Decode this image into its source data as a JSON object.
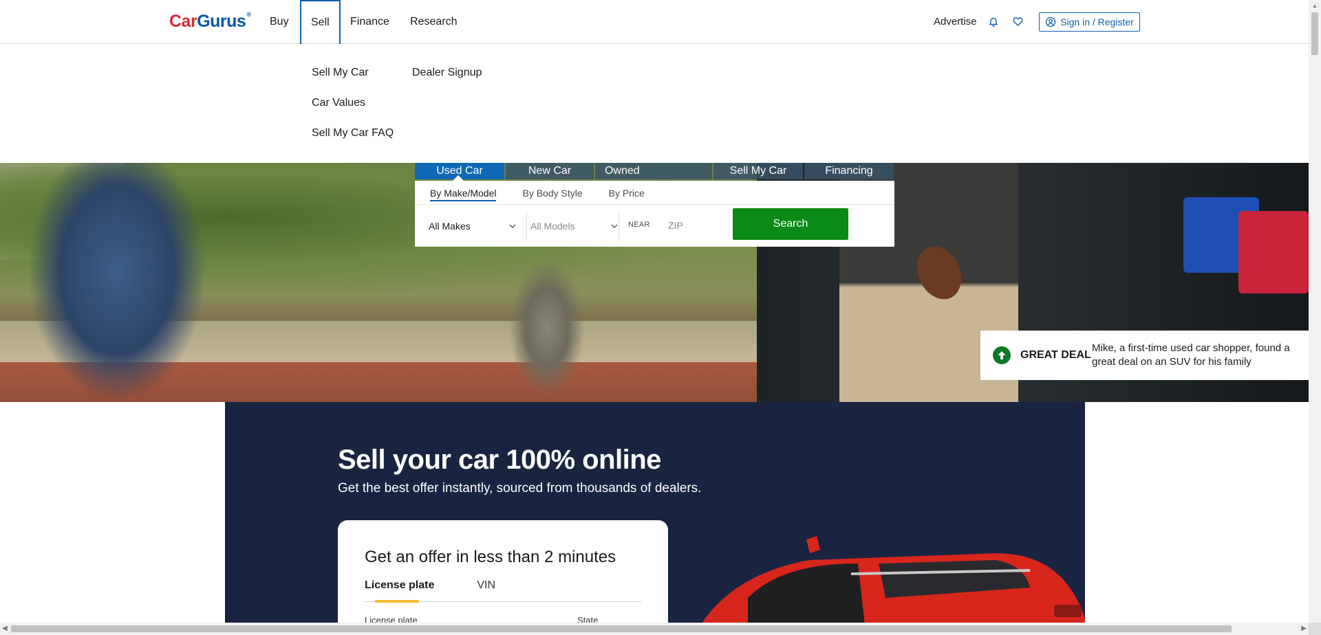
{
  "header": {
    "logo_car": "Car",
    "logo_gurus": "Gurus",
    "logo_reg": "®",
    "nav": {
      "buy": "Buy",
      "sell": "Sell",
      "finance": "Finance",
      "research": "Research"
    },
    "advertise": "Advertise",
    "signin": "Sign in / Register"
  },
  "sell_menu": {
    "sell_my_car": "Sell My Car",
    "car_values": "Car Values",
    "sell_faq": "Sell My Car FAQ",
    "dealer_signup": "Dealer Signup"
  },
  "search": {
    "tabs": [
      "Used Car",
      "New Car",
      "Certified Pre-Owned",
      "Sell My Car",
      "Financing"
    ],
    "active_tab": "Used Car",
    "subtabs": {
      "make_model": "By Make/Model",
      "body_style": "By Body Style",
      "price": "By Price"
    },
    "makes": "All Makes",
    "models": "All Models",
    "near": "NEAR",
    "zip_placeholder": "ZIP",
    "button": "Search"
  },
  "great_deal": {
    "label": "GREAT DEAL",
    "text": "Mike, a first-time used car shopper, found a great deal on an SUV for his family"
  },
  "sell_section": {
    "title": "Sell your car 100% online",
    "subtitle": "Get the best offer instantly, sourced from thousands of dealers.",
    "card_title": "Get an offer in less than 2 minutes",
    "tab_plate": "License plate",
    "tab_vin": "VIN",
    "field_plate": "License plate",
    "field_state": "State"
  },
  "colors": {
    "brand_blue": "#0d5fb0",
    "brand_red": "#d62b32",
    "search_green": "#0a8a16",
    "navy": "#182440",
    "deal_green": "#0a7a24",
    "tab_yellow": "#f5b82e"
  }
}
